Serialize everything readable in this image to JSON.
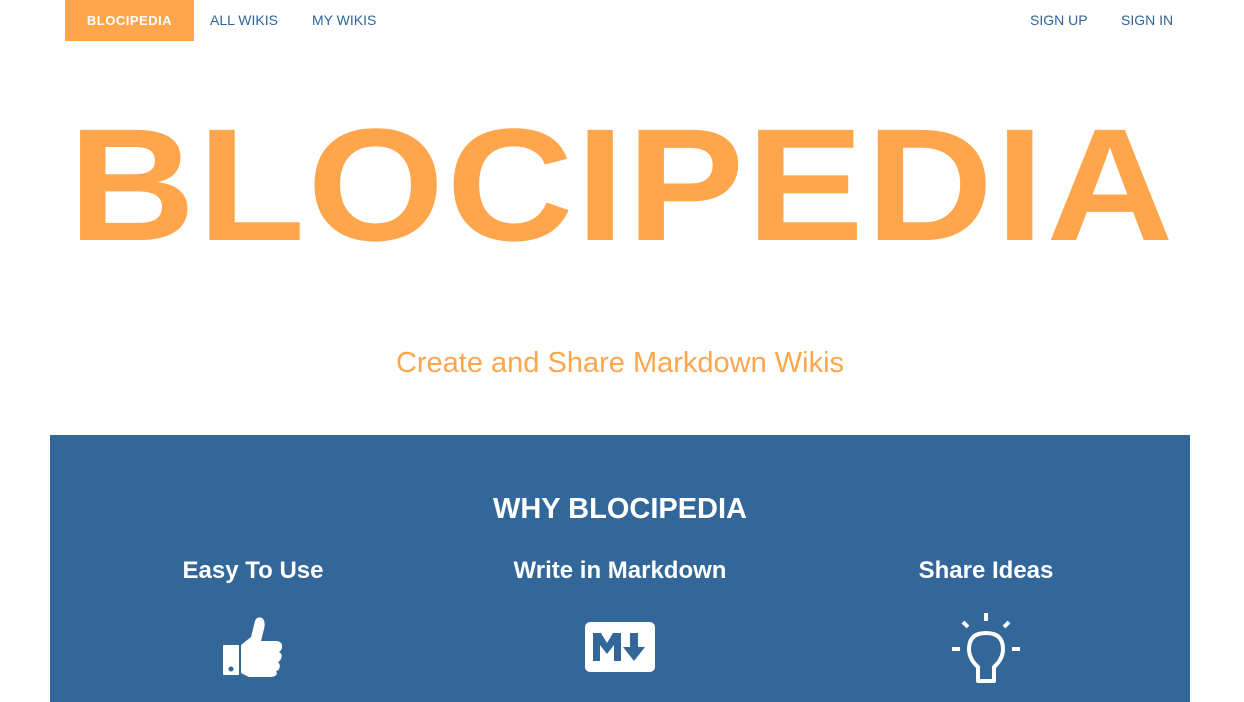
{
  "nav": {
    "brand": "BLOCIPEDIA",
    "all_wikis": "ALL WIKIS",
    "my_wikis": "MY WIKIS",
    "sign_up": "SIGN UP",
    "sign_in": "SIGN IN"
  },
  "hero": {
    "title": "BLOCIPEDIA",
    "subtitle": "Create and Share Markdown Wikis"
  },
  "why": {
    "heading": "WHY BLOCIPEDIA",
    "features": [
      {
        "title": "Easy To Use",
        "icon": "thumbs-up-icon"
      },
      {
        "title": "Write in Markdown",
        "icon": "markdown-icon"
      },
      {
        "title": "Share Ideas",
        "icon": "lightbulb-icon"
      }
    ]
  },
  "colors": {
    "accent": "#ffa64d",
    "section_bg": "#336699",
    "link": "#2f6496"
  }
}
